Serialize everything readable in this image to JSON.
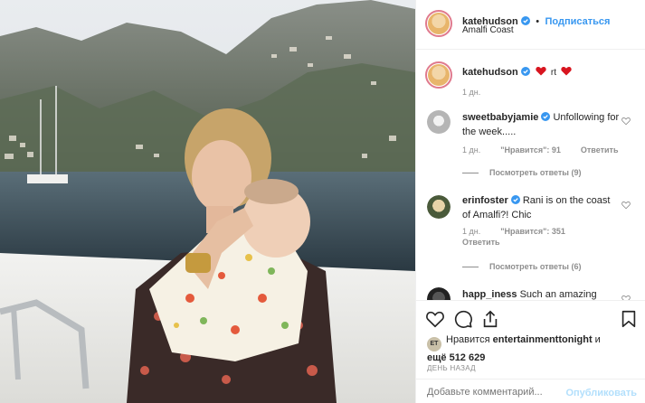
{
  "post": {
    "author": "katehudson",
    "follow_label": "Подписаться",
    "follow_separator": "•",
    "location": "Amalfi Coast"
  },
  "caption": {
    "author": "katehudson",
    "text_suffix": "rt",
    "time": "1 дн."
  },
  "comments": [
    {
      "author": "sweetbabyjamie",
      "text": "Unfollowing for the week.....",
      "time": "1 дн.",
      "likes": "\"Нравится\": 91",
      "reply_label": "Ответить",
      "view_replies": "Посмотреть ответы (9)"
    },
    {
      "author": "erinfoster",
      "text": "Rani is on the coast of Amalfi?! Chic",
      "time": "1 дн.",
      "likes": "\"Нравится\": 351",
      "reply_label": "Ответить",
      "view_replies": "Посмотреть ответы (6)"
    },
    {
      "author": "happ_iness",
      "text": "Such an amazing"
    }
  ],
  "likes": {
    "badge": "ET",
    "prefix": "Нравится",
    "user": "entertainmenttonight",
    "middle": "и",
    "more": "ещё 512 629"
  },
  "date_label": "ДЕНЬ НАЗАД",
  "composer": {
    "placeholder": "Добавьте комментарий...",
    "publish_label": "Опубликовать"
  },
  "colors": {
    "accent": "#3897f0",
    "heart": "#ed4956",
    "verified": "#3897f0"
  }
}
